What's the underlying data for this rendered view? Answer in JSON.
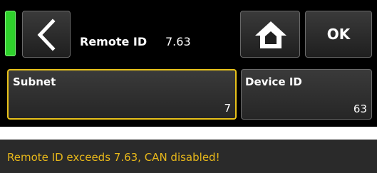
{
  "header": {
    "title": "Remote ID",
    "value": "7.63",
    "ok_label": "OK",
    "back_icon": "chevron-left-icon",
    "home_icon": "home-icon",
    "status_color": "#2fd12c"
  },
  "fields": [
    {
      "label": "Subnet",
      "value": "7",
      "selected": true
    },
    {
      "label": "Device ID",
      "value": "63",
      "selected": false
    }
  ],
  "colors": {
    "selected_border": "#e8c21a",
    "message_text": "#e8b81a",
    "background": "#000000"
  },
  "message": "Remote ID exceeds 7.63, CAN disabled!"
}
